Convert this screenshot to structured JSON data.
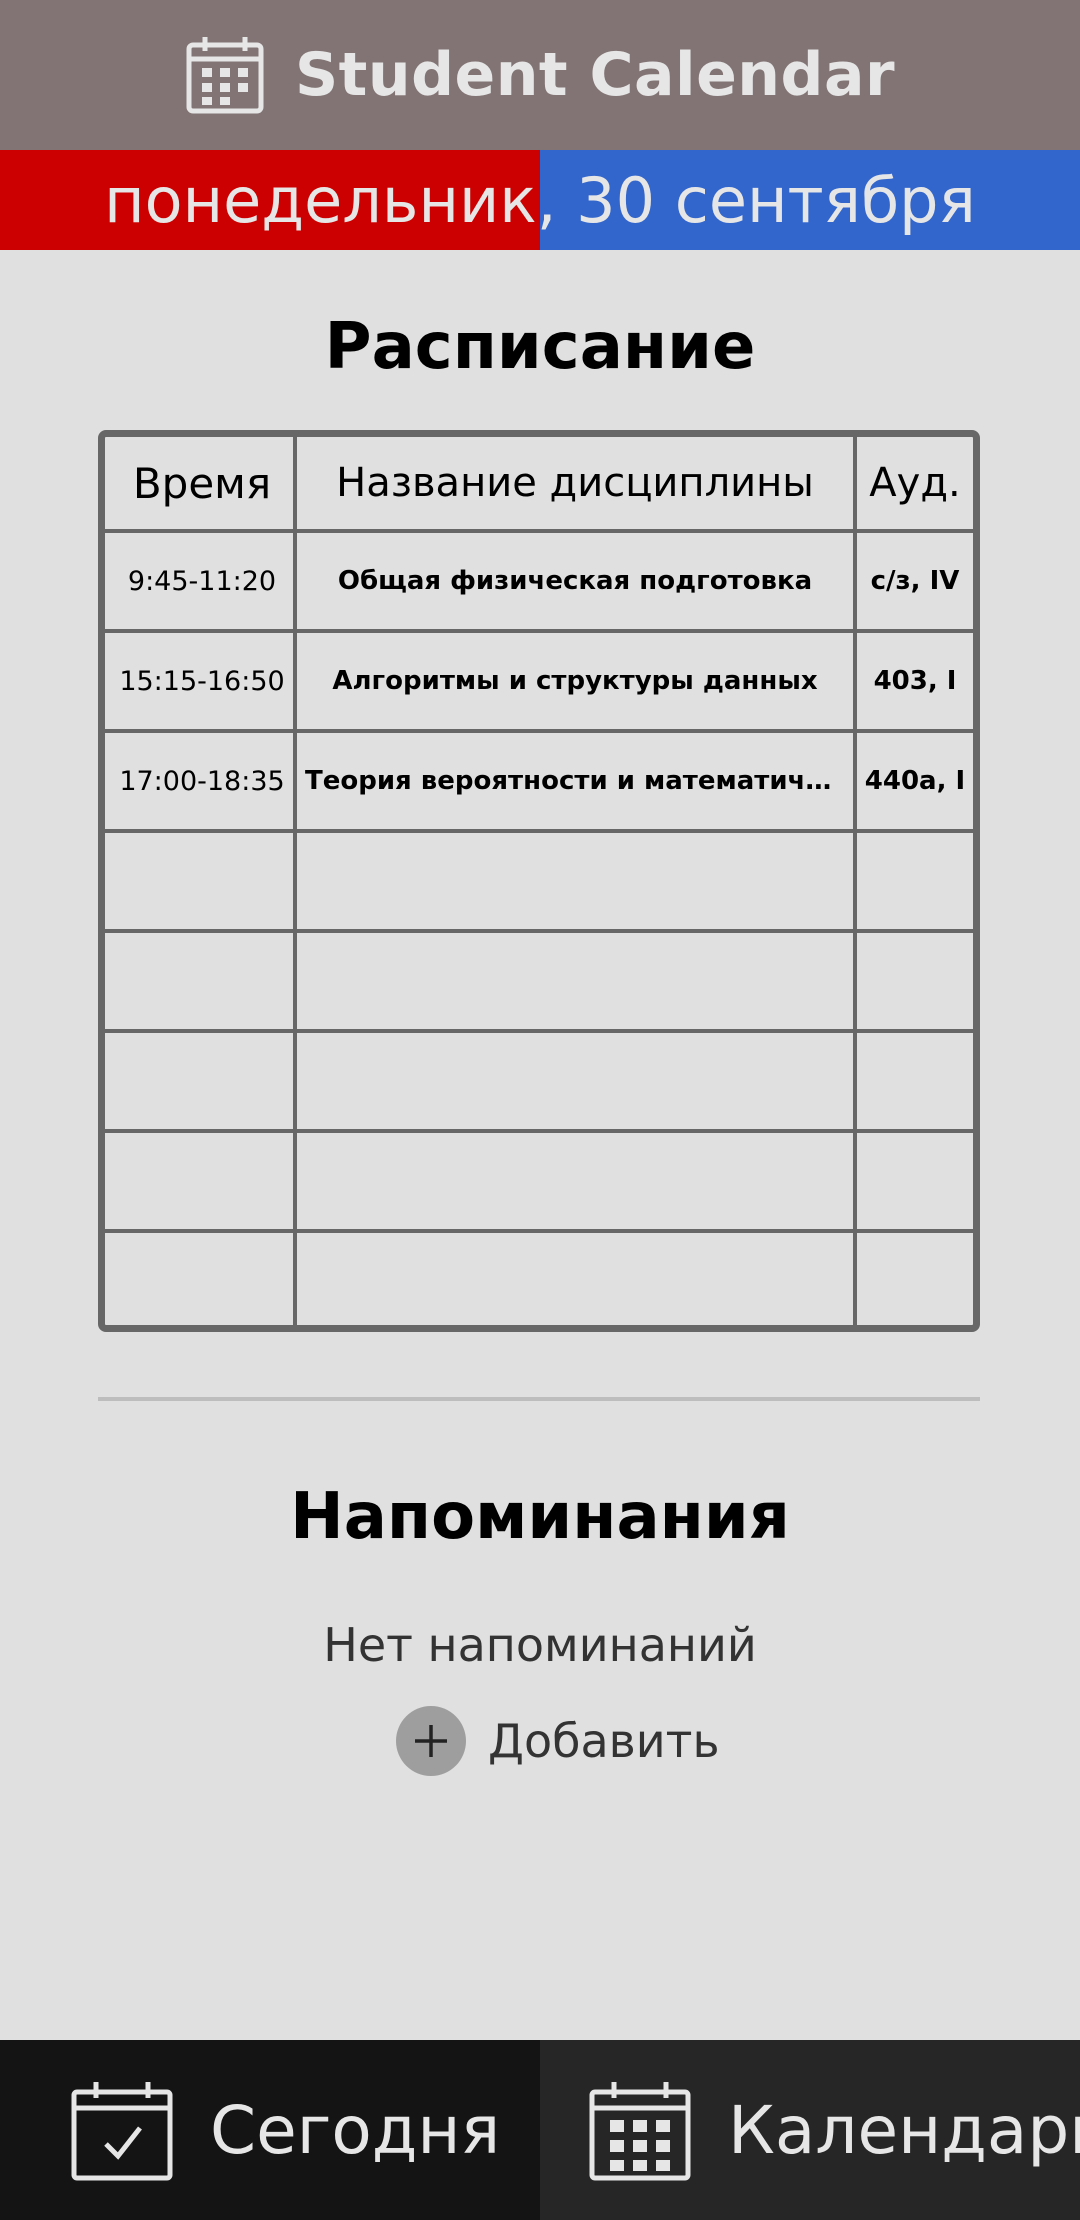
{
  "header": {
    "app_title": "Student Calendar",
    "icon": "calendar-icon"
  },
  "date_bar": {
    "text": "понедельник, 30 сентября",
    "left_color": "#cc0000",
    "right_color": "#3366cc"
  },
  "schedule": {
    "title": "Расписание",
    "columns": [
      "Время",
      "Название дисциплины",
      "Ауд."
    ],
    "rows": [
      {
        "time": "9:45-11:20",
        "name": "Общая физическая подготовка",
        "room": "с/з, IV"
      },
      {
        "time": "15:15-16:50",
        "name": "Алгоритмы и структуры данных",
        "room": "403, I"
      },
      {
        "time": "17:00-18:35",
        "name": "Теория вероятности и математиче...",
        "room": "440а, I"
      },
      {
        "time": "",
        "name": "",
        "room": ""
      },
      {
        "time": "",
        "name": "",
        "room": ""
      },
      {
        "time": "",
        "name": "",
        "room": ""
      },
      {
        "time": "",
        "name": "",
        "room": ""
      },
      {
        "time": "",
        "name": "",
        "room": ""
      }
    ]
  },
  "reminders": {
    "title": "Напоминания",
    "empty_text": "Нет напоминаний",
    "add_label": "Добавить",
    "add_icon": "plus-icon"
  },
  "bottom_nav": {
    "today_label": "Сегодня",
    "today_icon": "calendar-check-icon",
    "calendar_label": "Календарь",
    "calendar_icon": "calendar-grid-icon"
  }
}
